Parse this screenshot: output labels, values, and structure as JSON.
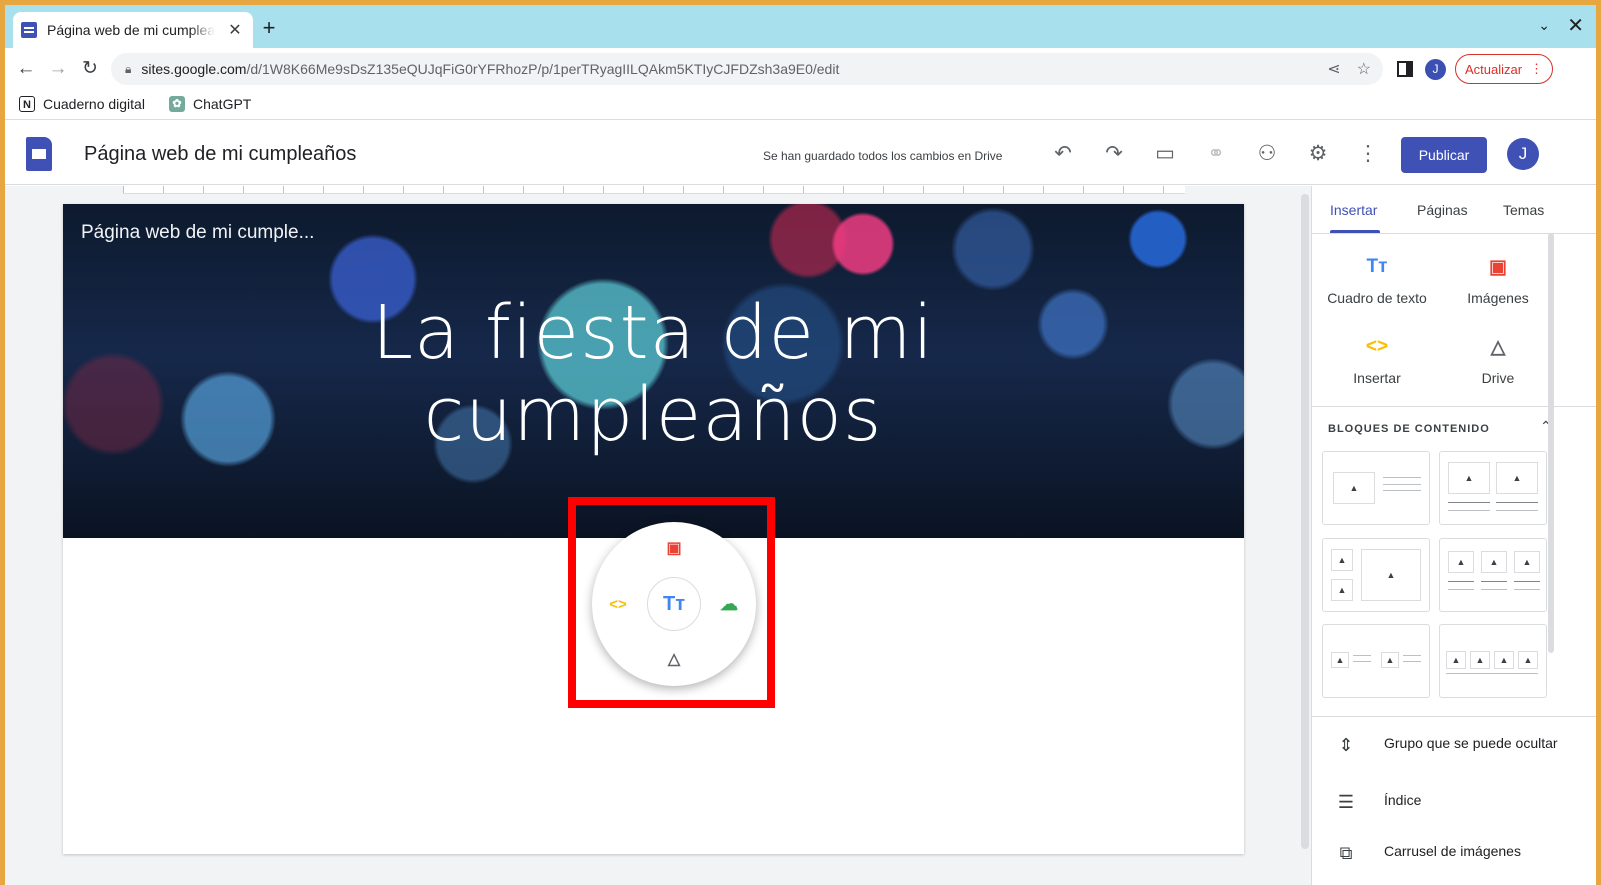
{
  "browser": {
    "tab_title": "Página web de mi cumpleaños",
    "tab_close": "✕",
    "new_tab": "+",
    "tab_list": "⌄",
    "window_close": "✕",
    "back": "←",
    "forward": "→",
    "reload": "↻",
    "url_host": "sites.google.com",
    "url_path": "/d/1W8K66Me9sDsZ135eQUJqFiG0rYFRhozP/p/1perTRyagIILQAkm5KTIyCJFDZsh3a9E0/edit",
    "profile_initial": "J",
    "update_label": "Actualizar",
    "update_menu": "⋮"
  },
  "bookmarks": [
    {
      "label": "Cuaderno digital",
      "icon": "notion-icon"
    },
    {
      "label": "ChatGPT",
      "icon": "chatgpt-icon"
    }
  ],
  "sites_header": {
    "site_name": "Página web de mi cumpleaños",
    "save_status": "Se han guardado todos los cambios en Drive",
    "publish_label": "Publicar",
    "profile_initial": "J"
  },
  "page": {
    "banner_site_name": "Página web de mi cumple...",
    "title": "La fiesta de mi cumpleaños"
  },
  "radial_menu": {
    "center_icon": "text-box-icon",
    "items": [
      "image-icon",
      "embed-code-icon",
      "upload-icon",
      "drive-icon"
    ]
  },
  "panel": {
    "tabs": [
      "Insertar",
      "Páginas",
      "Temas"
    ],
    "insert_items": [
      {
        "label": "Cuadro de texto",
        "icon": "text-box-icon",
        "color": "#4285f4"
      },
      {
        "label": "Imágenes",
        "icon": "image-icon",
        "color": "#ea4335"
      },
      {
        "label": "Insertar",
        "icon": "embed-code-icon",
        "color": "#fbbc04"
      },
      {
        "label": "Drive",
        "icon": "drive-icon",
        "color": "#5f6368"
      }
    ],
    "content_blocks_heading": "BLOQUES DE CONTENIDO",
    "list_items": [
      {
        "label": "Grupo que se puede ocultar",
        "icon": "collapsible-group-icon"
      },
      {
        "label": "Índice",
        "icon": "table-of-contents-icon"
      },
      {
        "label": "Carrusel de imágenes",
        "icon": "image-carousel-icon"
      }
    ]
  },
  "colors": {
    "accent": "#3f51b5",
    "tabstrip": "#a8e1ed",
    "highlight": "#ff0000",
    "update": "#d93025"
  }
}
